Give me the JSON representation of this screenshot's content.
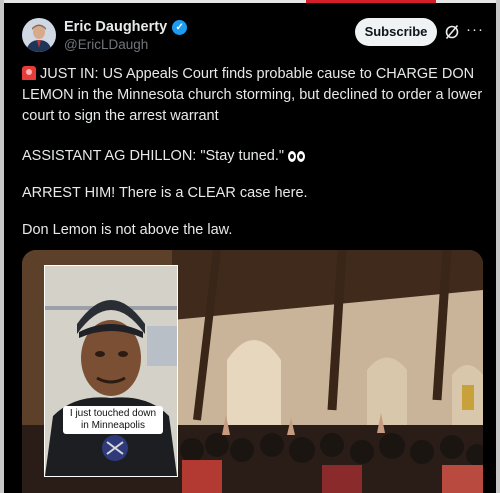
{
  "author": {
    "display_name": "Eric Daugherty",
    "handle": "@EricLDaugh",
    "verified": true
  },
  "actions": {
    "subscribe_label": "Subscribe"
  },
  "icons": {
    "verified": "verified-check-icon",
    "grok": "grok-icon",
    "more": "more-options-icon",
    "siren": "police-light-emoji",
    "eyes": "eyes-emoji"
  },
  "post": {
    "paragraphs": [
      "JUST IN: US Appeals Court finds probable cause to CHARGE DON LEMON in the Minnesota church storming, but declined to order a lower court to sign the arrest warrant",
      "ASSISTANT AG DHILLON: \"Stay tuned.\"",
      "ARREST HIM! There is a CLEAR case here.",
      "Don Lemon is not above the law."
    ]
  },
  "media": {
    "inset_caption": "I just touched down in Minneapolis"
  },
  "colors": {
    "background": "#000000",
    "text": "#e7e9ea",
    "secondary_text": "#71767b",
    "verified_blue": "#1d9bf0",
    "button_bg": "#eff3f4"
  }
}
